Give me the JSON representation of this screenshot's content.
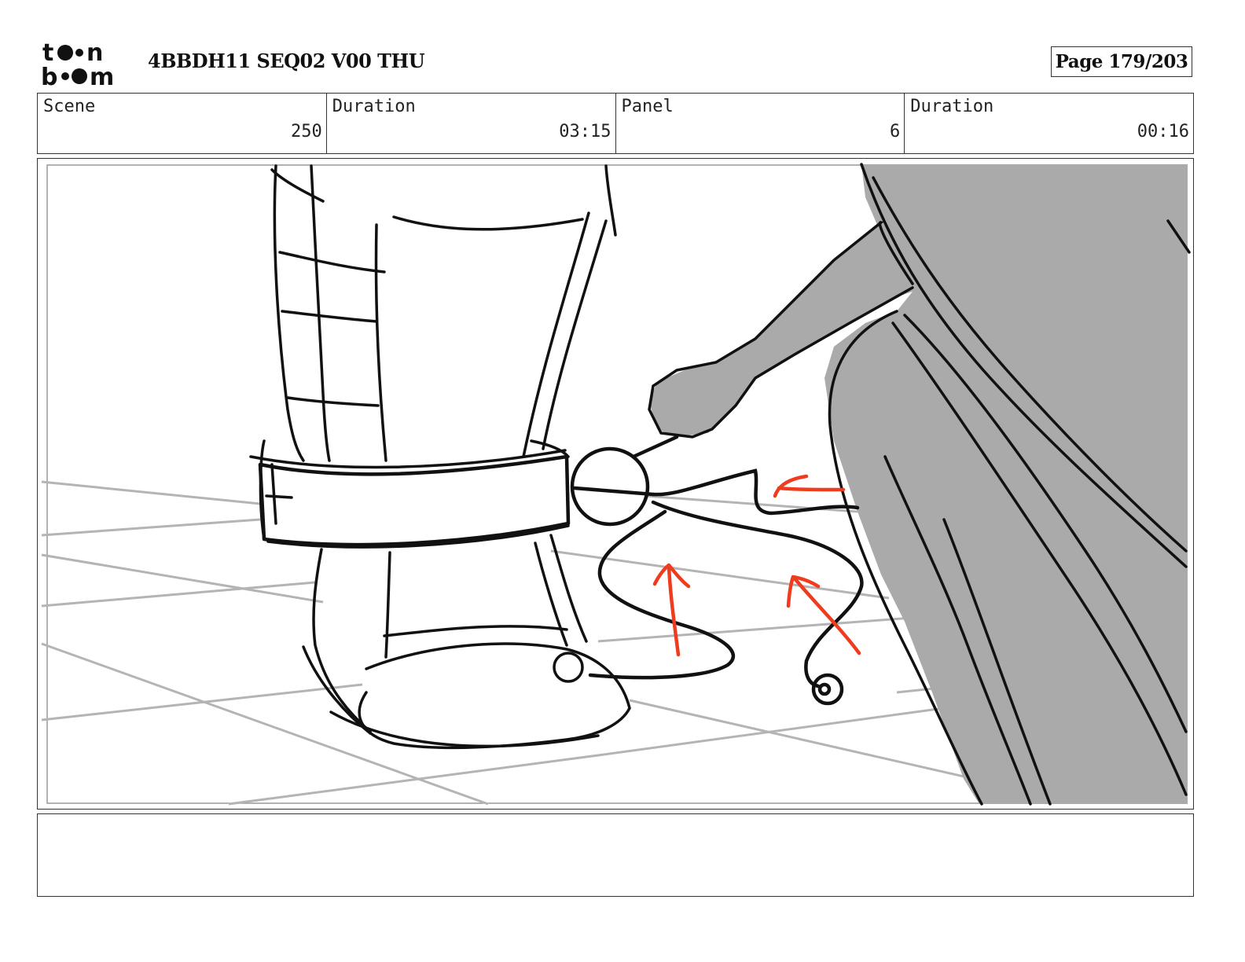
{
  "header": {
    "logo_alt": "toon boom",
    "doc_title": "4BBDH11 SEQ02 V00 THU",
    "page_label": "Page 179/203"
  },
  "info": {
    "scene_label": "Scene",
    "scene_value": "250",
    "scene_duration_label": "Duration",
    "scene_duration_value": "03:15",
    "panel_label": "Panel",
    "panel_value": "6",
    "panel_duration_label": "Duration",
    "panel_duration_value": "00:16"
  },
  "notes": {
    "text": ""
  },
  "colors": {
    "accent_arrow": "#f03c1e",
    "shadow_gray": "#aaaaaa",
    "floor_grid": "#b4b4b4"
  }
}
